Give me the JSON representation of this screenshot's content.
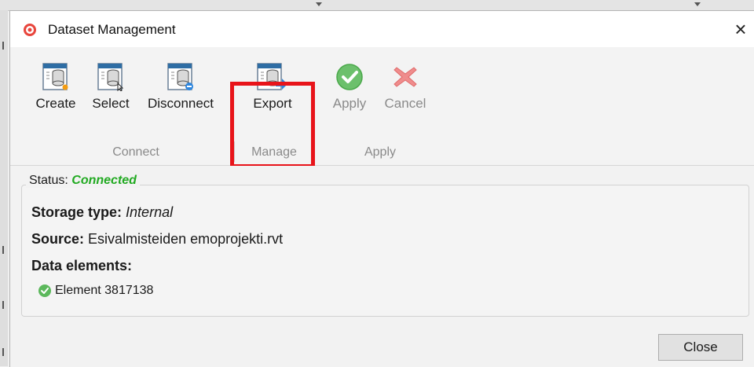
{
  "window": {
    "title": "Dataset Management"
  },
  "ribbon": {
    "tools": [
      {
        "id": "create",
        "label": "Create",
        "icon": "create-dataset-icon",
        "enabled": true
      },
      {
        "id": "select",
        "label": "Select",
        "icon": "select-dataset-icon",
        "enabled": true
      },
      {
        "id": "disconnect",
        "label": "Disconnect",
        "icon": "disconnect-dataset-icon",
        "enabled": true
      },
      {
        "id": "export",
        "label": "Export",
        "icon": "export-dataset-icon",
        "enabled": true,
        "highlighted": true
      },
      {
        "id": "apply",
        "label": "Apply",
        "icon": "check-circle-icon",
        "enabled": false
      },
      {
        "id": "cancel",
        "label": "Cancel",
        "icon": "cross-icon",
        "enabled": false
      }
    ],
    "groups": {
      "connect": "Connect",
      "manage": "Manage",
      "apply": "Apply"
    }
  },
  "details": {
    "status_label": "Status:",
    "status_value": "Connected",
    "storage_label": "Storage type:",
    "storage_value": "Internal",
    "source_label": "Source:",
    "source_value": "Esivalmisteiden emoprojekti.rvt",
    "elements_label": "Data elements:",
    "elements": [
      {
        "label": "Element 3817138",
        "icon": "check-circle-icon"
      }
    ]
  },
  "footer": {
    "close_label": "Close"
  },
  "colors": {
    "highlight": "#e8141a",
    "status_connected": "#22aa22",
    "apply_green": "#5cb85c",
    "cancel_red": "#e86a6a"
  }
}
